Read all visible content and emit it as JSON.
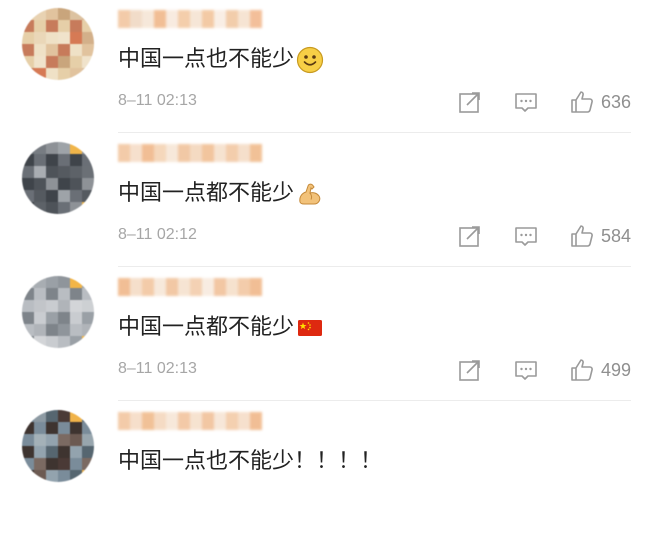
{
  "comments": [
    {
      "text": "中国一点也不能少",
      "emoji": "smiley-face",
      "time": "8–11 02:13",
      "likes": "636",
      "avatar_colors": [
        "#e6cfa8",
        "#d9b894",
        "#efe1c6",
        "#c9a57c",
        "#d67a55",
        "#e8d2b2",
        "#c77b5b",
        "#ead7b8",
        "#dcc2a0",
        "#f0e3cb",
        "#e1c39e",
        "#d3b08a"
      ],
      "name_colors": [
        "#f2c6a0",
        "#f0d9c4",
        "#f6e6d6",
        "#f0b88a",
        "#f8e9dd",
        "#f3c9a2",
        "#f6e4d3",
        "#f2c59c",
        "#f9ede3",
        "#f1c8a3",
        "#f6e2cf",
        "#f2b990"
      ]
    },
    {
      "text": "中国一点都不能少",
      "emoji": "flexed-biceps",
      "time": "8–11 02:12",
      "likes": "584",
      "avatar_colors": [
        "#6a6f76",
        "#8a8f95",
        "#4e5359",
        "#9ea3a8",
        "#5d6268",
        "#777c82",
        "#3f444a",
        "#a9adb2",
        "#f0b54a",
        "#555a60",
        "#8e9297",
        "#6b7076"
      ],
      "name_colors": [
        "#f2c6a0",
        "#f6ddc8",
        "#f0b88a",
        "#f4d3b4",
        "#f7e6d6",
        "#f0c39c",
        "#f3d6bc",
        "#f1bf94",
        "#f6e0cc",
        "#f2c8a4",
        "#f5dcc6",
        "#f0bb8c"
      ]
    },
    {
      "text": "中国一点都不能少",
      "emoji": "china-flag",
      "time": "8–11 02:13",
      "likes": "499",
      "avatar_colors": [
        "#b9bdc2",
        "#9fa5ab",
        "#c9ccd0",
        "#8f959b",
        "#d3d5d8",
        "#a8adb2",
        "#7e848a",
        "#c2c5c9",
        "#f2b548",
        "#b0b4b9",
        "#9aa0a6",
        "#cdd0d3"
      ],
      "name_colors": [
        "#f0b88a",
        "#f5dcc6",
        "#f2c6a0",
        "#f7e7d8",
        "#f1c39c",
        "#f6e2cf",
        "#f3cdac",
        "#f8ebdf",
        "#f1c19a",
        "#f6dfc9",
        "#f2c7a2",
        "#f0b88a"
      ]
    },
    {
      "text": "中国一点也不能少！！！！",
      "emoji": "",
      "time": "",
      "likes": "",
      "avatar_colors": [
        "#7a8c9a",
        "#5e6f7c",
        "#93a3ae",
        "#4a3a36",
        "#6c5a52",
        "#8d9aa3",
        "#3e3430",
        "#a4b1b8",
        "#f0b34a",
        "#7b6a62",
        "#566670",
        "#98a6ae"
      ],
      "name_colors": [
        "#f2c6a0",
        "#f6dcc6",
        "#f0bb8c",
        "#f5d8be",
        "#f7e6d7",
        "#f2c49e",
        "#f6e0cc",
        "#f1c19a",
        "#f7e5d5",
        "#f3cba8",
        "#f6ddc8",
        "#f0b88a"
      ]
    }
  ],
  "icons": {
    "share": "share-icon",
    "reply": "reply-icon",
    "like": "thumbs-up-icon"
  },
  "colors": {
    "text": "#222222",
    "meta": "#a6a6a6",
    "icon": "#9a9a9a"
  }
}
